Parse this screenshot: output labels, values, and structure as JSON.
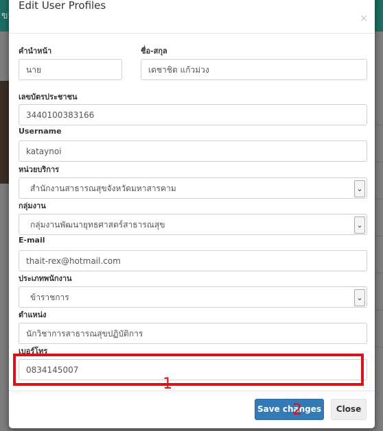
{
  "background": {
    "navbar_text": "ขจั"
  },
  "modal": {
    "title": "Edit User Profiles",
    "close_symbol": "×"
  },
  "fields": {
    "prefix": {
      "label": "คำนำหน้า",
      "value": "นาย"
    },
    "fullname": {
      "label": "ชื่อ-สกุล",
      "value": "เดชาชิต  แก้วม่วง"
    },
    "id_card": {
      "label": "เลขบัตรประชาชน",
      "value": "3440100383166"
    },
    "username": {
      "label": "Username",
      "value": "kataynoi"
    },
    "unit": {
      "label": "หน่วยบริการ",
      "value": "สำนักงานสาธารณสุขจังหวัดมหาสารคาม"
    },
    "workgroup": {
      "label": "กลุ่มงาน",
      "value": "กลุ่มงานพัฒนายุทธศาสตร์สาธารณสุข"
    },
    "email": {
      "label": "E-mail",
      "value": "thait-rex@hotmail.com"
    },
    "employee_type": {
      "label": "ประเภทพนักงาน",
      "value": "ข้าราชการ"
    },
    "position": {
      "label": "ตำแหน่ง",
      "value": "นักวิชาการสาธารณสุขปฏิบัติการ"
    },
    "phone": {
      "label": "เบอร์โทร",
      "value": "0834145007"
    }
  },
  "annotations": {
    "marker_1": "1",
    "marker_2": "2",
    "highlight_color": "#d6151a"
  },
  "buttons": {
    "save": "Save changes",
    "close": "Close"
  },
  "colors": {
    "primary": "#337ab7",
    "navbar": "#1e6e64"
  }
}
